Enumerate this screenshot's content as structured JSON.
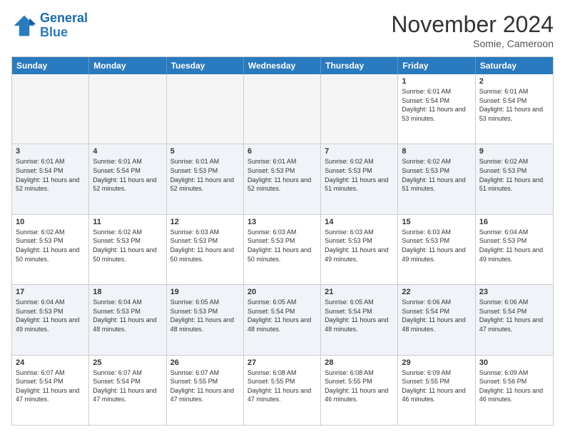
{
  "header": {
    "logo_line1": "General",
    "logo_line2": "Blue",
    "month": "November 2024",
    "location": "Somie, Cameroon"
  },
  "weekdays": [
    "Sunday",
    "Monday",
    "Tuesday",
    "Wednesday",
    "Thursday",
    "Friday",
    "Saturday"
  ],
  "rows": [
    [
      {
        "day": "",
        "text": ""
      },
      {
        "day": "",
        "text": ""
      },
      {
        "day": "",
        "text": ""
      },
      {
        "day": "",
        "text": ""
      },
      {
        "day": "",
        "text": ""
      },
      {
        "day": "1",
        "text": "Sunrise: 6:01 AM\nSunset: 5:54 PM\nDaylight: 11 hours and 53 minutes."
      },
      {
        "day": "2",
        "text": "Sunrise: 6:01 AM\nSunset: 5:54 PM\nDaylight: 11 hours and 53 minutes."
      }
    ],
    [
      {
        "day": "3",
        "text": "Sunrise: 6:01 AM\nSunset: 5:54 PM\nDaylight: 11 hours and 52 minutes."
      },
      {
        "day": "4",
        "text": "Sunrise: 6:01 AM\nSunset: 5:54 PM\nDaylight: 11 hours and 52 minutes."
      },
      {
        "day": "5",
        "text": "Sunrise: 6:01 AM\nSunset: 5:53 PM\nDaylight: 11 hours and 52 minutes."
      },
      {
        "day": "6",
        "text": "Sunrise: 6:01 AM\nSunset: 5:53 PM\nDaylight: 11 hours and 52 minutes."
      },
      {
        "day": "7",
        "text": "Sunrise: 6:02 AM\nSunset: 5:53 PM\nDaylight: 11 hours and 51 minutes."
      },
      {
        "day": "8",
        "text": "Sunrise: 6:02 AM\nSunset: 5:53 PM\nDaylight: 11 hours and 51 minutes."
      },
      {
        "day": "9",
        "text": "Sunrise: 6:02 AM\nSunset: 5:53 PM\nDaylight: 11 hours and 51 minutes."
      }
    ],
    [
      {
        "day": "10",
        "text": "Sunrise: 6:02 AM\nSunset: 5:53 PM\nDaylight: 11 hours and 50 minutes."
      },
      {
        "day": "11",
        "text": "Sunrise: 6:02 AM\nSunset: 5:53 PM\nDaylight: 11 hours and 50 minutes."
      },
      {
        "day": "12",
        "text": "Sunrise: 6:03 AM\nSunset: 5:53 PM\nDaylight: 11 hours and 50 minutes."
      },
      {
        "day": "13",
        "text": "Sunrise: 6:03 AM\nSunset: 5:53 PM\nDaylight: 11 hours and 50 minutes."
      },
      {
        "day": "14",
        "text": "Sunrise: 6:03 AM\nSunset: 5:53 PM\nDaylight: 11 hours and 49 minutes."
      },
      {
        "day": "15",
        "text": "Sunrise: 6:03 AM\nSunset: 5:53 PM\nDaylight: 11 hours and 49 minutes."
      },
      {
        "day": "16",
        "text": "Sunrise: 6:04 AM\nSunset: 5:53 PM\nDaylight: 11 hours and 49 minutes."
      }
    ],
    [
      {
        "day": "17",
        "text": "Sunrise: 6:04 AM\nSunset: 5:53 PM\nDaylight: 11 hours and 49 minutes."
      },
      {
        "day": "18",
        "text": "Sunrise: 6:04 AM\nSunset: 5:53 PM\nDaylight: 11 hours and 48 minutes."
      },
      {
        "day": "19",
        "text": "Sunrise: 6:05 AM\nSunset: 5:53 PM\nDaylight: 11 hours and 48 minutes."
      },
      {
        "day": "20",
        "text": "Sunrise: 6:05 AM\nSunset: 5:54 PM\nDaylight: 11 hours and 48 minutes."
      },
      {
        "day": "21",
        "text": "Sunrise: 6:05 AM\nSunset: 5:54 PM\nDaylight: 11 hours and 48 minutes."
      },
      {
        "day": "22",
        "text": "Sunrise: 6:06 AM\nSunset: 5:54 PM\nDaylight: 11 hours and 48 minutes."
      },
      {
        "day": "23",
        "text": "Sunrise: 6:06 AM\nSunset: 5:54 PM\nDaylight: 11 hours and 47 minutes."
      }
    ],
    [
      {
        "day": "24",
        "text": "Sunrise: 6:07 AM\nSunset: 5:54 PM\nDaylight: 11 hours and 47 minutes."
      },
      {
        "day": "25",
        "text": "Sunrise: 6:07 AM\nSunset: 5:54 PM\nDaylight: 11 hours and 47 minutes."
      },
      {
        "day": "26",
        "text": "Sunrise: 6:07 AM\nSunset: 5:55 PM\nDaylight: 11 hours and 47 minutes."
      },
      {
        "day": "27",
        "text": "Sunrise: 6:08 AM\nSunset: 5:55 PM\nDaylight: 11 hours and 47 minutes."
      },
      {
        "day": "28",
        "text": "Sunrise: 6:08 AM\nSunset: 5:55 PM\nDaylight: 11 hours and 46 minutes."
      },
      {
        "day": "29",
        "text": "Sunrise: 6:09 AM\nSunset: 5:55 PM\nDaylight: 11 hours and 46 minutes."
      },
      {
        "day": "30",
        "text": "Sunrise: 6:09 AM\nSunset: 5:56 PM\nDaylight: 11 hours and 46 minutes."
      }
    ]
  ]
}
